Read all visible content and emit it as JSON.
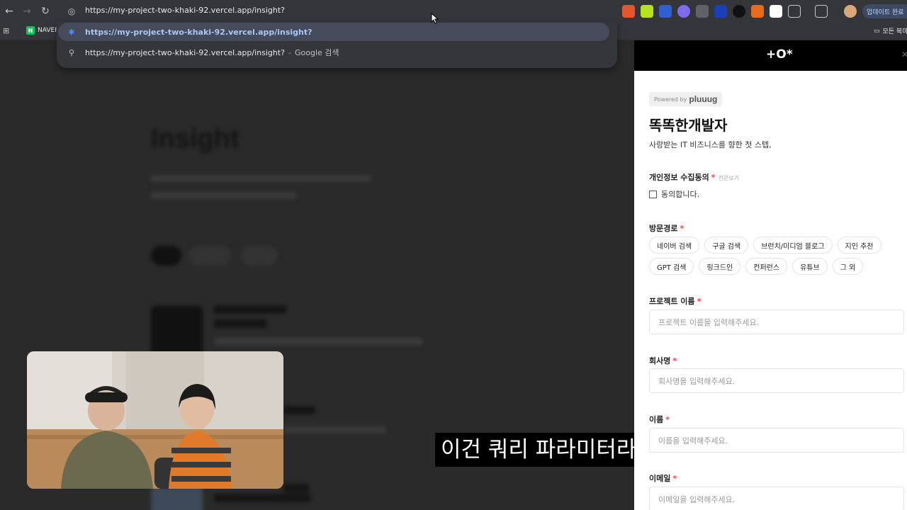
{
  "browser": {
    "url": "https://my-project-two-khaki-92.vercel.app/insight?",
    "suggestions": [
      {
        "text": "https://my-project-two-khaki-92.vercel.app/insight?",
        "sub": ""
      },
      {
        "text": "https://my-project-two-khaki-92.vercel.app/insight?",
        "sub": "Google 검색"
      }
    ],
    "bookmarks": {
      "naver": "NAVER",
      "all_bookmarks": "모든 북마"
    },
    "update_label": "업데이트 완료",
    "extensions": [
      "fox-icon",
      "lime-icon",
      "shield-icon",
      "cloud-icon",
      "camera-icon",
      "stats-icon",
      "triangle-icon",
      "flame-icon",
      "notion-icon",
      "puzzle-icon",
      "cast-icon"
    ]
  },
  "page": {
    "title": "Insight"
  },
  "subtitle": "이건 쿼리 파라미터라고 하는데",
  "form": {
    "logo": "+O*",
    "powered_prefix": "Powered by",
    "powered_brand": "pluuug",
    "title": "똑똑한개발자",
    "subtitle": "사랑받는 IT 비즈니스를 향한 첫 스텝,",
    "privacy_label": "개인정보 수집동의",
    "privacy_view": "전문보기",
    "agree_label": "동의합니다.",
    "source_label": "방문경로",
    "source_chips_row1": [
      "네이버 검색",
      "구글 검색",
      "브런치/미디엄 블로그",
      "지인 추천"
    ],
    "source_chips_row2": [
      "GPT 검색",
      "링크드인",
      "컨퍼런스",
      "유튜브",
      "그 외"
    ],
    "project_label": "프로젝트 이름",
    "project_placeholder": "프로젝트 이름을 입력해주세요.",
    "company_label": "회사명",
    "company_placeholder": "회사명을 입력해주세요.",
    "name_label": "이름",
    "name_placeholder": "이름을 입력해주세요.",
    "email_label": "이메일",
    "email_placeholder": "이메일을 입력해주세요.",
    "required_mark": "*"
  },
  "colors": {
    "accent": "#a8c7fa",
    "required": "#e5484d",
    "naver": "#03c75a"
  }
}
